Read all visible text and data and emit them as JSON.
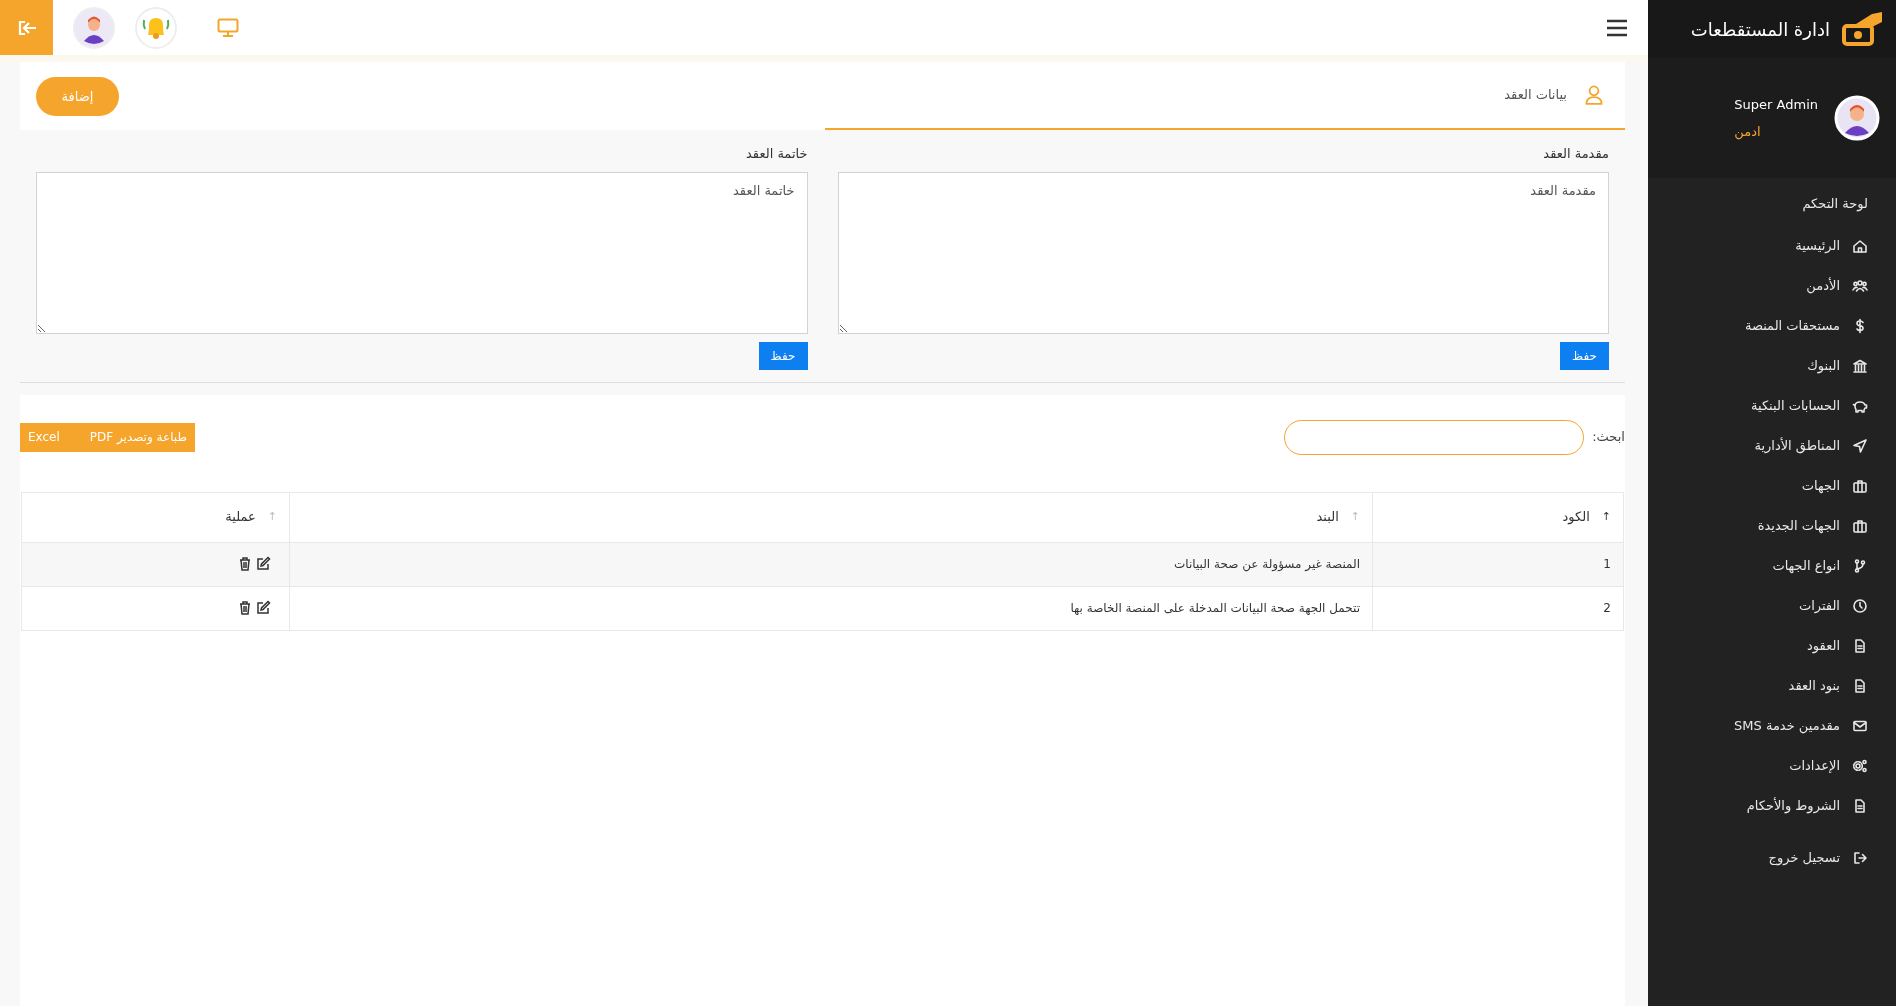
{
  "sidebar": {
    "brand": "ادارة المستقطعات",
    "user": {
      "name": "Super Admin",
      "role": "ادمن"
    },
    "section_title": "لوحة التحكم",
    "items": [
      {
        "label": "الرئيسية"
      },
      {
        "label": "الأدمن"
      },
      {
        "label": "مستحقات المنصة"
      },
      {
        "label": "البنوك"
      },
      {
        "label": "الحسابات البنكية"
      },
      {
        "label": "المناطق الأدارية"
      },
      {
        "label": "الجهات"
      },
      {
        "label": "الجهات الجديدة"
      },
      {
        "label": "انواع الجهات"
      },
      {
        "label": "الفترات"
      },
      {
        "label": "العقود"
      },
      {
        "label": "بنود العقد"
      },
      {
        "label": "مقدمين خدمة SMS"
      },
      {
        "label": "الإعدادات"
      },
      {
        "label": "الشروط والأحكام"
      }
    ],
    "logout": "تسجيل خروج"
  },
  "tabs": [
    {
      "label": "بيانات العقد",
      "selected": true
    }
  ],
  "add_button": "إضافة",
  "fields": [
    {
      "label": "مقدمة العقد",
      "value": "مقدمة العقد",
      "save": "حفظ"
    },
    {
      "label": "خاتمة العقد",
      "value": "خاتمة العقد",
      "save": "حفظ"
    }
  ],
  "search": {
    "label": "ابحث:"
  },
  "export_buttons": [
    "طباعة وتصدير PDF",
    "Excel"
  ],
  "table": {
    "columns": [
      {
        "label": "الكود",
        "sort_arrow": "↑",
        "sorted": true
      },
      {
        "label": "البند",
        "sort_arrow": "↑",
        "sorted": false
      },
      {
        "label": "عملية",
        "sort_arrow": "↑",
        "sorted": false
      }
    ],
    "rows": [
      {
        "code": "1",
        "item": "المنصة غير مسؤولة عن صحة البيانات"
      },
      {
        "code": "2",
        "item": "تتحمل الجهة صحة البيانات المدخلة على المنصة الخاصة بها"
      }
    ]
  }
}
